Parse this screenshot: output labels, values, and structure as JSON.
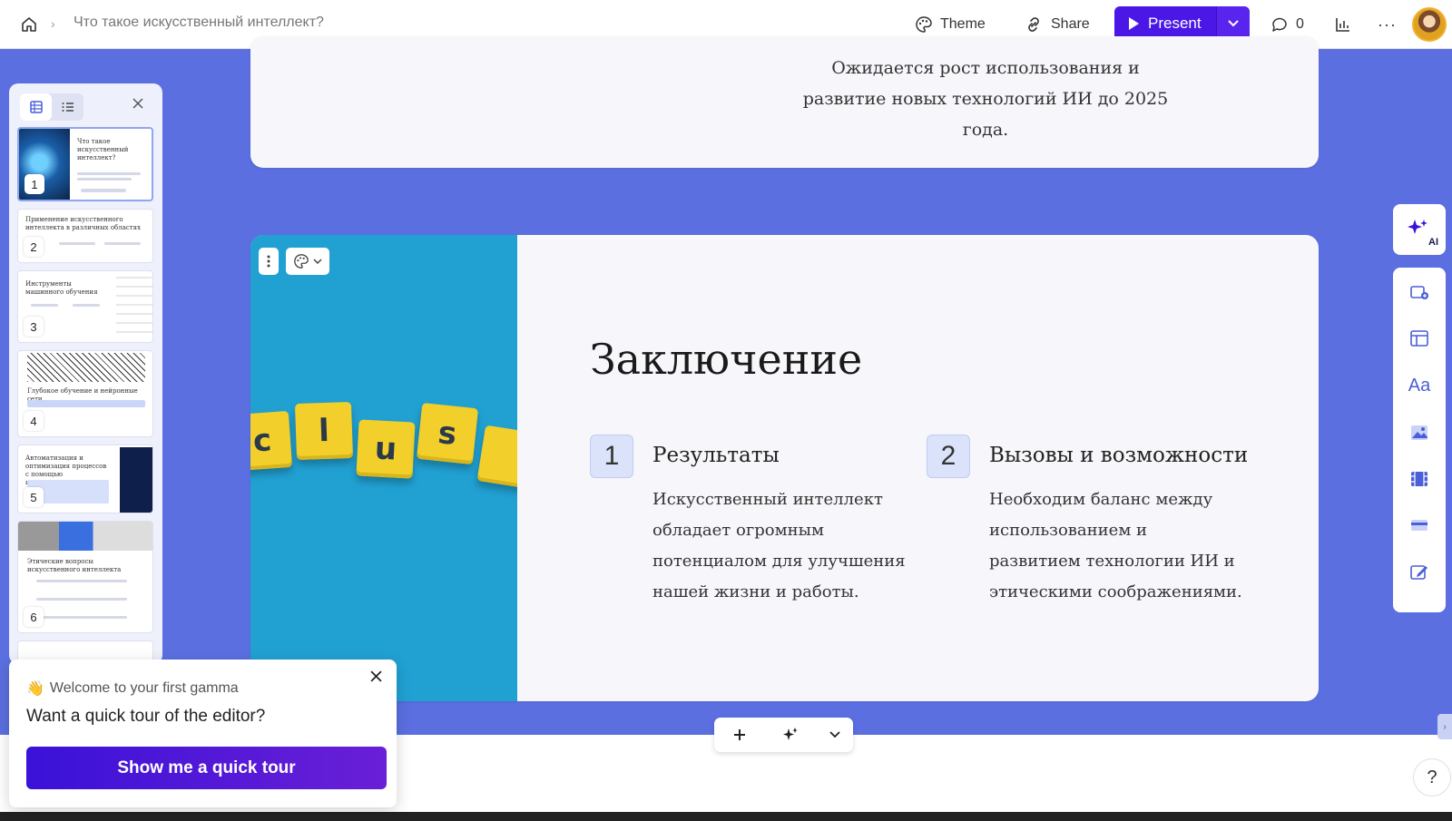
{
  "header": {
    "doc_title": "Что такое искусственный интеллект?",
    "theme_label": "Theme",
    "share_label": "Share",
    "present_label": "Present",
    "comments_count": "0",
    "more_label": "···"
  },
  "slides_panel": {
    "thumbnails": [
      {
        "number": "1",
        "title": "Что такое искусственный интеллект?"
      },
      {
        "number": "2",
        "title": "Применение искусственного интеллекта в различных областях"
      },
      {
        "number": "3",
        "title": "Инструменты машинного обучения"
      },
      {
        "number": "4",
        "title": "Глубокое обучение и нейронные сети"
      },
      {
        "number": "5",
        "title": "Автоматизация и оптимизация процессов с помощью искусственного интеллекта"
      },
      {
        "number": "6",
        "title": "Этические вопросы искусственного интеллекта"
      }
    ]
  },
  "top_card": {
    "text": "Ожидается рост использования и развитие новых технологий ИИ до 2025 года."
  },
  "main_card": {
    "heading": "Заключение",
    "tiles": [
      "c",
      "l",
      "u",
      "s"
    ],
    "points": [
      {
        "number": "1",
        "title": "Результаты",
        "body": "Искусственный интеллект обладает огромным потенциалом для улучшения нашей жизни и работы."
      },
      {
        "number": "2",
        "title": "Вызовы и возможности",
        "body": "Необходим баланс между использованием и развитием технологии ИИ и этическими соображениями."
      }
    ]
  },
  "rail": {
    "ai_label": "AI"
  },
  "welcome": {
    "emoji": "👋",
    "line1": "Welcome to your first gamma",
    "line2": "Want a quick tour of the editor?",
    "button": "Show me a quick tour"
  },
  "help_label": "?",
  "colors": {
    "accent": "#4a17e6",
    "canvas": "#5b6fe0",
    "card": "#f7f7fb",
    "number_box": "#dbe3fb",
    "image_bg": "#21a1d2",
    "tile": "#f2cf2a"
  }
}
